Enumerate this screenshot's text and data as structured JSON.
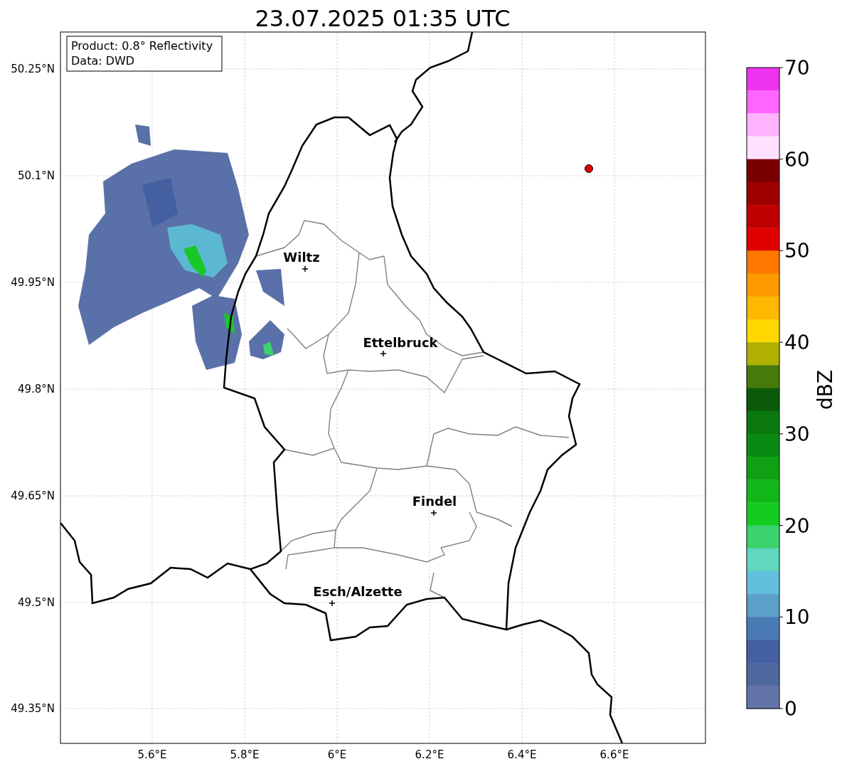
{
  "title": "23.07.2025 01:35 UTC",
  "info_box": {
    "lines": [
      "Product: 0.8° Reflectivity",
      "Data: DWD"
    ]
  },
  "map": {
    "lat_ticks": [
      "50.25°N",
      "50.1°N",
      "49.95°N",
      "49.8°N",
      "49.65°N",
      "49.5°N",
      "49.35°N"
    ],
    "lon_ticks": [
      "5.6°E",
      "5.8°E",
      "6°E",
      "6.2°E",
      "6.4°E",
      "6.6°E"
    ],
    "cities": [
      {
        "name": "Wiltz"
      },
      {
        "name": "Ettelbruck"
      },
      {
        "name": "Findel"
      },
      {
        "name": "Esch/Alzette"
      }
    ]
  },
  "colorbar": {
    "label": "dBZ",
    "ticks": [
      "70",
      "60",
      "50",
      "40",
      "30",
      "20",
      "10",
      "0"
    ],
    "bands": [
      {
        "color": "#ee33ee"
      },
      {
        "color": "#ff66ff"
      },
      {
        "color": "#ffb3ff"
      },
      {
        "color": "#ffe0ff"
      },
      {
        "color": "#7a0000"
      },
      {
        "color": "#9e0000"
      },
      {
        "color": "#c00000"
      },
      {
        "color": "#e00000"
      },
      {
        "color": "#ff7700"
      },
      {
        "color": "#ff9900"
      },
      {
        "color": "#ffb800"
      },
      {
        "color": "#ffd800"
      },
      {
        "color": "#b0b000"
      },
      {
        "color": "#467a0a"
      },
      {
        "color": "#0a5a0a"
      },
      {
        "color": "#0a780f"
      },
      {
        "color": "#0a8a14"
      },
      {
        "color": "#10a014"
      },
      {
        "color": "#12b81a"
      },
      {
        "color": "#14cc1e"
      },
      {
        "color": "#3cd26e"
      },
      {
        "color": "#60d8c0"
      },
      {
        "color": "#62c0dc"
      },
      {
        "color": "#5aa0c8"
      },
      {
        "color": "#4a7ab4"
      },
      {
        "color": "#4460a0"
      },
      {
        "color": "#5068a0"
      },
      {
        "color": "#6474a8"
      }
    ]
  }
}
